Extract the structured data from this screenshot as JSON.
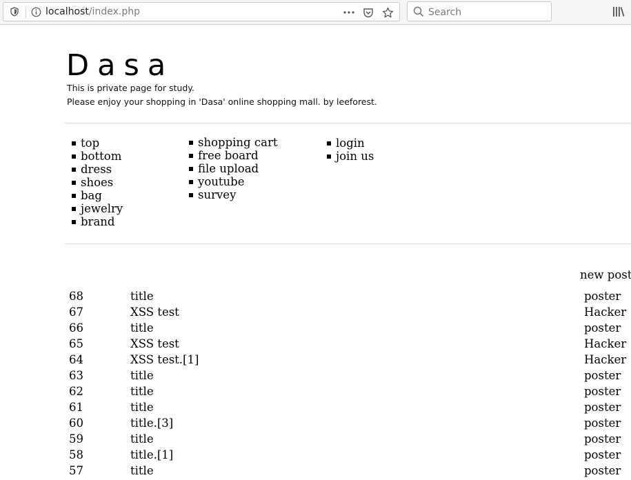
{
  "browser": {
    "url_host": "localhost",
    "url_path": "/index.php",
    "search_placeholder": "Search",
    "more_icon": "more-dots-icon",
    "pocket_icon": "pocket-icon",
    "bookmark_icon": "star-icon"
  },
  "header": {
    "logo": "Dasa",
    "tagline_1": "This is private page for study.",
    "tagline_2": "Please enjoy your shopping in 'Dasa' online shopping mall. by leeforest."
  },
  "menu": {
    "col1": [
      "top",
      "bottom",
      "dress",
      "shoes",
      "bag",
      "jewelry",
      "brand"
    ],
    "col2": [
      "shopping cart",
      "free board",
      "file upload",
      "youtube",
      "survey"
    ],
    "col3": [
      "login",
      "join us"
    ]
  },
  "board": {
    "new_post_label": "new post",
    "rows": [
      {
        "num": "68",
        "title": "title",
        "poster": "poster"
      },
      {
        "num": "67",
        "title": "XSS test",
        "poster": "Hacker"
      },
      {
        "num": "66",
        "title": "title",
        "poster": "poster"
      },
      {
        "num": "65",
        "title": "XSS test",
        "poster": "Hacker"
      },
      {
        "num": "64",
        "title": "XSS test.[1]",
        "poster": "Hacker"
      },
      {
        "num": "63",
        "title": "title",
        "poster": "poster"
      },
      {
        "num": "62",
        "title": "title",
        "poster": "poster"
      },
      {
        "num": "61",
        "title": "title",
        "poster": "poster"
      },
      {
        "num": "60",
        "title": "title.[3]",
        "poster": "poster"
      },
      {
        "num": "59",
        "title": "title",
        "poster": "poster"
      },
      {
        "num": "58",
        "title": "title.[1]",
        "poster": "poster"
      },
      {
        "num": "57",
        "title": "title",
        "poster": "poster"
      }
    ]
  }
}
